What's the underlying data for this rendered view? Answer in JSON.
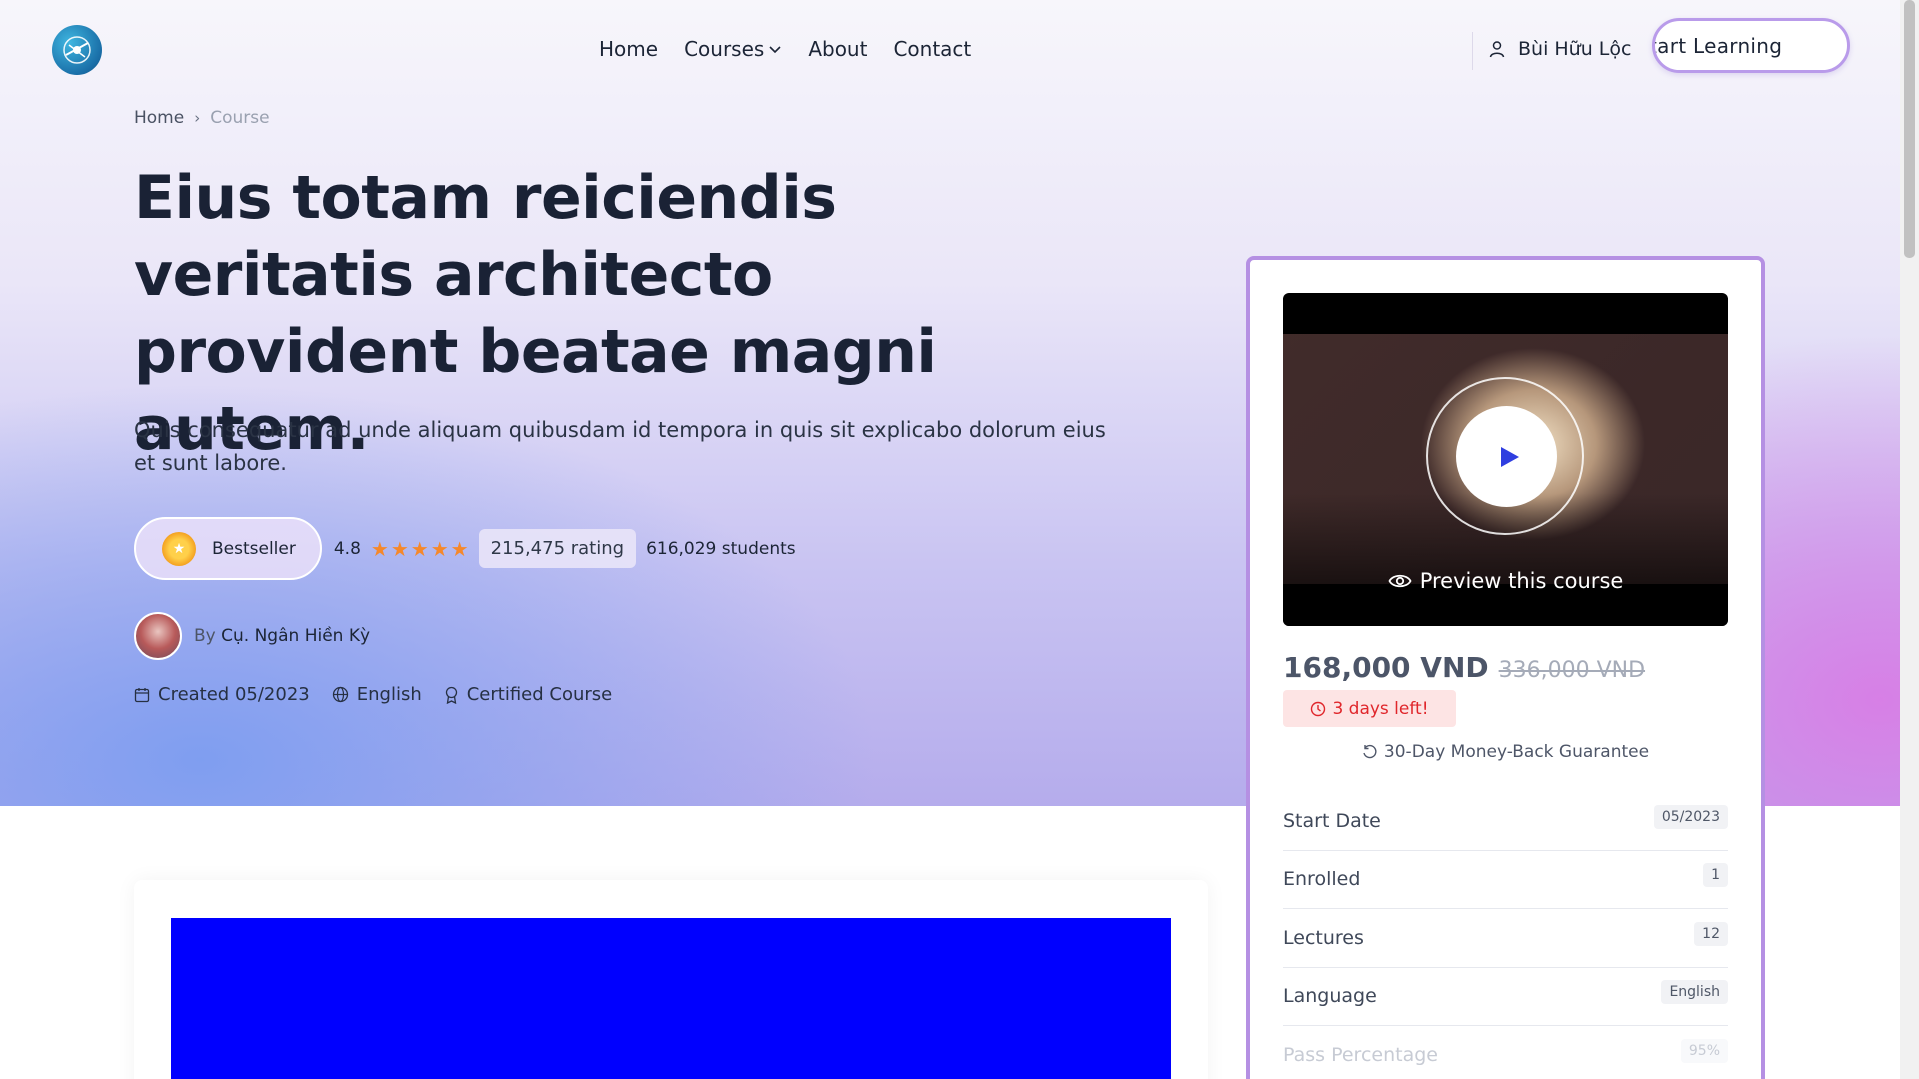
{
  "header": {
    "nav": [
      {
        "label": "Home"
      },
      {
        "label": "Courses"
      },
      {
        "label": "About"
      },
      {
        "label": "Contact"
      }
    ],
    "user_name": "Bùi Hữu Lộc",
    "cta_label": "tart Learning"
  },
  "breadcrumb": {
    "home": "Home",
    "separator": "›",
    "current": "Course"
  },
  "course": {
    "title": "Eius totam reiciendis veritatis architecto provident beatae magni autem.",
    "subtitle": "Quis consequatur ad unde aliquam quibusdam id tempora in quis sit explicabo dolorum eius et sunt labore.",
    "badge": "Bestseller",
    "rating": "4.8",
    "stars": 5,
    "rating_count": "215,475 rating",
    "students": "616,029 students",
    "author_prefix": "By",
    "author_name": "Cụ. Ngân Hiền Kỳ",
    "created": "Created 05/2023",
    "language": "English",
    "certified": "Certified Course"
  },
  "sidebar": {
    "preview_label": "Preview this course",
    "price_now": "168,000 VND",
    "price_old": "336,000 VND",
    "days_left": "3 days left!",
    "guarantee": "30-Day Money-Back Guarantee",
    "details": [
      {
        "label": "Start Date",
        "value": "05/2023"
      },
      {
        "label": "Enrolled",
        "value": "1"
      },
      {
        "label": "Lectures",
        "value": "12"
      },
      {
        "label": "Language",
        "value": "English"
      },
      {
        "label": "Pass Percentage",
        "value": "95%"
      }
    ]
  },
  "colors": {
    "accent": "#b590e3",
    "star": "#f5882b",
    "alert": "#e0262b",
    "content_block": "#0000ff"
  }
}
